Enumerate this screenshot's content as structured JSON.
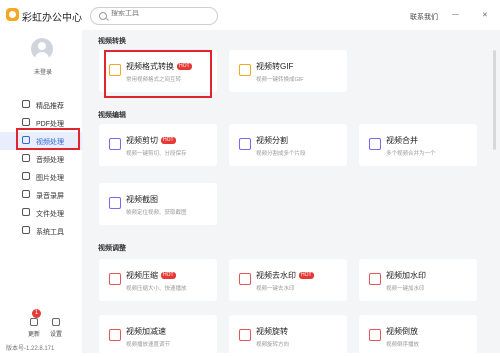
{
  "app": {
    "title": "彩虹办公中心"
  },
  "search": {
    "placeholder": "搜索工具"
  },
  "titlebar": {
    "link": "联系我们",
    "minimize": "—",
    "close": "✕"
  },
  "user": {
    "login_label": "未登录"
  },
  "sidebar": {
    "items": [
      {
        "label": "精品推荐",
        "icon": "star-icon"
      },
      {
        "label": "PDF处理",
        "icon": "pdf-icon"
      },
      {
        "label": "视频处理",
        "icon": "video-icon",
        "active": true
      },
      {
        "label": "音频处理",
        "icon": "audio-icon"
      },
      {
        "label": "图片处理",
        "icon": "image-icon"
      },
      {
        "label": "录音录屏",
        "icon": "record-icon"
      },
      {
        "label": "文件处理",
        "icon": "file-icon"
      },
      {
        "label": "系统工具",
        "icon": "tools-icon"
      }
    ],
    "bottom": {
      "update_label": "更新",
      "update_badge": "1",
      "settings_label": "设置"
    },
    "version": "版本号-1.22.8.171"
  },
  "sections": {
    "convert": {
      "title": "视频转换"
    },
    "edit": {
      "title": "视频编辑"
    },
    "adjust": {
      "title": "视频调整"
    }
  },
  "cards": {
    "format": {
      "title": "视频格式转换",
      "hot": "HOT",
      "desc": "常用视频格式之间互转"
    },
    "gif": {
      "title": "视频转GIF",
      "desc": "视频一键转换成GIF"
    },
    "cut": {
      "title": "视频剪切",
      "hot": "HOT",
      "desc": "视频一键剪切、分段保存"
    },
    "split": {
      "title": "视频分割",
      "desc": "视频分割成多个片段"
    },
    "merge": {
      "title": "视频合并",
      "desc": "多个视频合并为一个"
    },
    "screenshot": {
      "title": "视频截图",
      "desc": "帧频定位视频、获取截图"
    },
    "compress": {
      "title": "视频压缩",
      "hot": "HOT",
      "desc": "视频压缩大小、快速播放"
    },
    "dewatermark": {
      "title": "视频去水印",
      "hot": "HOT",
      "desc": "视频一键去水印"
    },
    "watermark": {
      "title": "视频加水印",
      "desc": "视频一键加水印"
    },
    "speed": {
      "title": "视频加减速",
      "desc": "视频播放速度调节"
    },
    "rotate": {
      "title": "视频旋转",
      "desc": "视频旋转方向"
    },
    "reverse": {
      "title": "视频倒放",
      "desc": "视频倒序播放"
    }
  }
}
